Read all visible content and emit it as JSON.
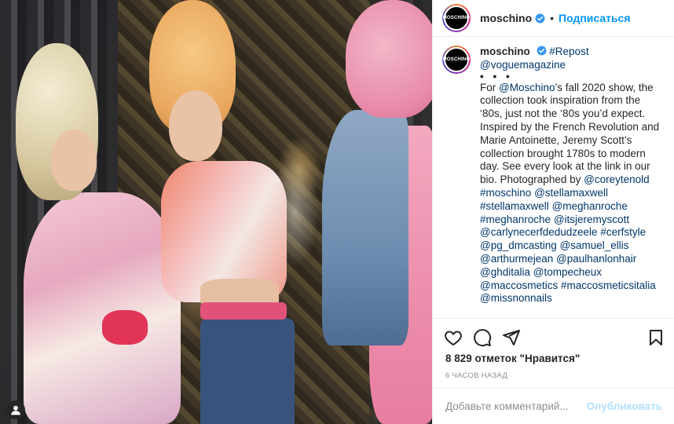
{
  "photo": {
    "alt_icon": "user-tag-icon"
  },
  "header": {
    "username": "moschino",
    "avatar_text": "MOSCHINO",
    "dot": "•",
    "follow_label": "Подписаться"
  },
  "caption": {
    "username": "moschino",
    "repost_tag": "#Repost",
    "source": "@voguemagazine",
    "ellipsis": "• • •",
    "line_for": "For ",
    "mention_moschino": "@Moschino",
    "text_1": "’s fall 2020 show, the collection took inspiration from the ‘80s, just not the ‘80s you’d expect. Inspired by the French Revolution and Marie Antoinette, Jeremy Scott’s collection brought 1780s to modern day. See every look at the link in our bio. Photographed by ",
    "mention_corey": "@coreytenold",
    "tags": [
      "#moschino",
      "@stellamaxwell",
      "#stellamaxwell",
      "@meghanroche",
      "#meghanroche",
      "@itsjeremyscott",
      "@carlynecerfdedudzeele",
      "#cerfstyle",
      "@pg_dmcasting",
      "@samuel_ellis",
      "@arthurmejean",
      "@paulhanlonhair",
      "@ghditalia",
      "@tompecheux",
      "@maccosmetics",
      "#maccosmeticsitalia",
      "@missnonnails"
    ]
  },
  "actions": {
    "likes": "8 829 отметок \"Нравится\"",
    "timestamp": "6 ЧАСОВ НАЗАД"
  },
  "comment": {
    "placeholder": "Добавьте комментарий...",
    "publish_label": "Опубликовать"
  },
  "colors": {
    "accent": "#0095f6",
    "link": "#00376b",
    "verified": "#3897f0",
    "publish_disabled": "#b2dffc"
  }
}
